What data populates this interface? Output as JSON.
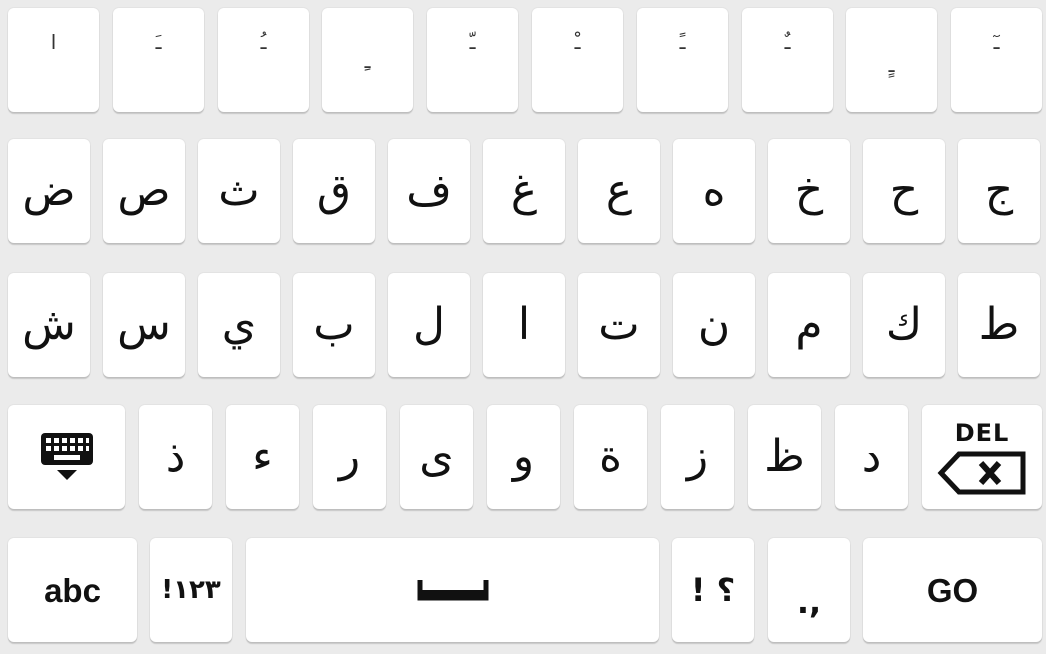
{
  "rows": {
    "diacritics": [
      "ا",
      "ـَ",
      "ـُ",
      "ـِ",
      "ـّ",
      "ـْ",
      "ـً",
      "ـٌ",
      "ـٍ",
      "ـٓ"
    ],
    "row1": [
      "ض",
      "ص",
      "ث",
      "ق",
      "ف",
      "غ",
      "ع",
      "ه",
      "خ",
      "ح",
      "ج"
    ],
    "row2": [
      "ش",
      "س",
      "ي",
      "ب",
      "ل",
      "ا",
      "ت",
      "ن",
      "م",
      "ك",
      "ط"
    ],
    "row3": [
      "ذ",
      "ء",
      "ر",
      "ى",
      "و",
      "ة",
      "ز",
      "ظ",
      "د"
    ]
  },
  "keys": {
    "hide_keyboard_icon": "keyboard-hide-icon",
    "delete_label": "DEL",
    "delete_icon": "backspace-icon",
    "abc_label": "abc",
    "numbers_label": "!١٢٣",
    "space_icon": "space-bar-icon",
    "punctuation_label": "! ؟",
    "comma_period_label": ".,",
    "go_label": "GO"
  },
  "colors": {
    "background": "#ebebeb",
    "key": "#ffffff",
    "text": "#111111"
  }
}
